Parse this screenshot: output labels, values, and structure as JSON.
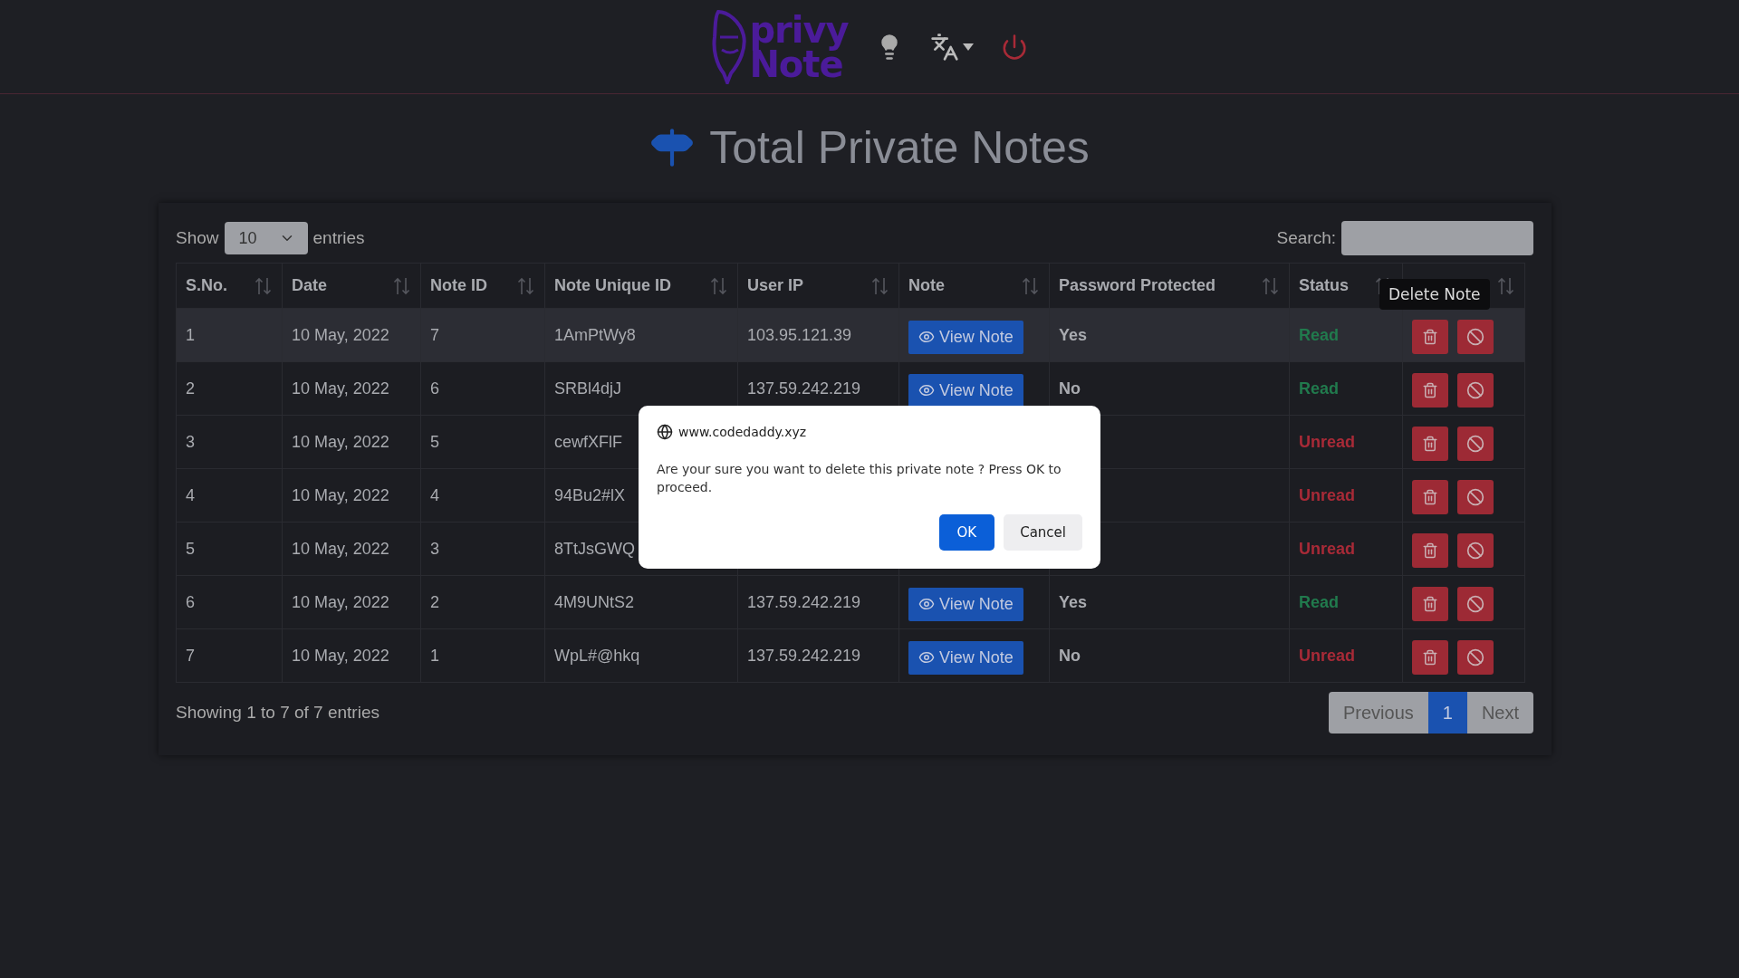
{
  "header": {
    "logo": {
      "line_1": "privy",
      "line_2": "Note"
    },
    "language_menu": {
      "expanded": false
    }
  },
  "title": "Total Private Notes",
  "table_controls": {
    "show_label": "Show",
    "page_size": "10",
    "entries_label": "entries",
    "search_label": "Search:"
  },
  "table": {
    "columns": [
      {
        "label": "S.No."
      },
      {
        "label": "Date"
      },
      {
        "label": "Note ID"
      },
      {
        "label": "Note Unique ID"
      },
      {
        "label": "User IP"
      },
      {
        "label": "Note"
      },
      {
        "label": "Password Protected"
      },
      {
        "label": "Status"
      },
      {}
    ],
    "rows": [
      {
        "hovered": true,
        "sno": "1",
        "date": "10 May, 2022",
        "note_id": "7",
        "unique_id": "1AmPtWy8",
        "ip": "103.95.121.39",
        "note_button": "View Note",
        "password": "Yes",
        "status": {
          "text": "Read",
          "kind": "read"
        }
      },
      {
        "hovered": false,
        "sno": "2",
        "date": "10 May, 2022",
        "note_id": "6",
        "unique_id": "SRBl4djJ",
        "ip": "137.59.242.219",
        "note_button": "View Note",
        "password": "No",
        "status": {
          "text": "Read",
          "kind": "read"
        }
      },
      {
        "hovered": false,
        "sno": "3",
        "date": "10 May, 2022",
        "note_id": "5",
        "unique_id": "cewfXFlF",
        "status": {
          "text": "Unread",
          "kind": "unread"
        }
      },
      {
        "hovered": false,
        "sno": "4",
        "date": "10 May, 2022",
        "note_id": "4",
        "unique_id": "94Bu2#lX",
        "status": {
          "text": "Unread",
          "kind": "unread"
        }
      },
      {
        "hovered": false,
        "sno": "5",
        "date": "10 May, 2022",
        "note_id": "3",
        "unique_id": "8TtJsGWQ",
        "status": {
          "text": "Unread",
          "kind": "unread"
        }
      },
      {
        "hovered": false,
        "sno": "6",
        "date": "10 May, 2022",
        "note_id": "2",
        "unique_id": "4M9UNtS2",
        "ip": "137.59.242.219",
        "note_button": "View Note",
        "password": "Yes",
        "status": {
          "text": "Read",
          "kind": "read"
        }
      },
      {
        "hovered": false,
        "sno": "7",
        "date": "10 May, 2022",
        "note_id": "1",
        "unique_id": "WpL#@hkq",
        "ip": "137.59.242.219",
        "note_button": "View Note",
        "password": "No",
        "status": {
          "text": "Unread",
          "kind": "unread"
        }
      }
    ]
  },
  "tooltip": "Delete Note",
  "footer": {
    "info": "Showing 1 to 7 of 7 entries",
    "pagination": [
      {
        "label": "Previous",
        "selected": false
      },
      {
        "label": "1",
        "selected": true
      },
      {
        "label": "Next",
        "selected": false
      }
    ]
  },
  "dialog": {
    "site": "www.codedaddy.xyz",
    "message": "Are your sure you want to delete this private note ? Press OK to proceed.",
    "buttons": [
      {
        "label": "OK",
        "kind": "primary"
      },
      {
        "label": "Cancel",
        "kind": "secondary"
      }
    ]
  }
}
